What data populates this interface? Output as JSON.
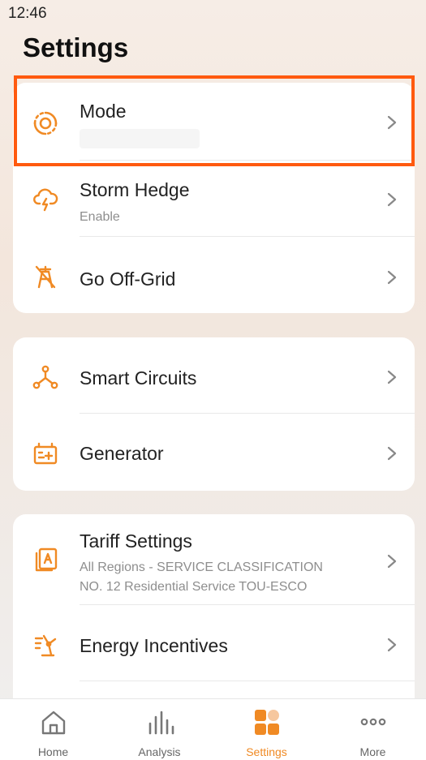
{
  "status_bar": {
    "time": "12:46"
  },
  "page": {
    "title": "Settings"
  },
  "colors": {
    "accent": "#f08a24",
    "highlight": "#ff5a0f"
  },
  "groups": [
    {
      "items": [
        {
          "icon": "mode-icon",
          "label": "Mode",
          "sub": ""
        },
        {
          "icon": "storm-cloud-icon",
          "label": "Storm Hedge",
          "sub": "Enable"
        },
        {
          "icon": "off-grid-icon",
          "label": "Go Off-Grid",
          "sub": ""
        }
      ]
    },
    {
      "items": [
        {
          "icon": "smart-circuits-icon",
          "label": "Smart Circuits",
          "sub": ""
        },
        {
          "icon": "generator-icon",
          "label": "Generator",
          "sub": ""
        }
      ]
    },
    {
      "items": [
        {
          "icon": "tariff-icon",
          "label": "Tariff Settings",
          "sub": [
            "All Regions - SERVICE CLASSIFICATION",
            "NO. 12 Residential Service TOU-ESCO"
          ]
        },
        {
          "icon": "energy-incentives-icon",
          "label": "Energy Incentives",
          "sub": ""
        }
      ]
    }
  ],
  "tabbar": {
    "active": "Settings",
    "items": [
      {
        "icon": "home-icon",
        "label": "Home"
      },
      {
        "icon": "analysis-icon",
        "label": "Analysis"
      },
      {
        "icon": "settings-grid-icon",
        "label": "Settings"
      },
      {
        "icon": "more-icon",
        "label": "More"
      }
    ]
  }
}
